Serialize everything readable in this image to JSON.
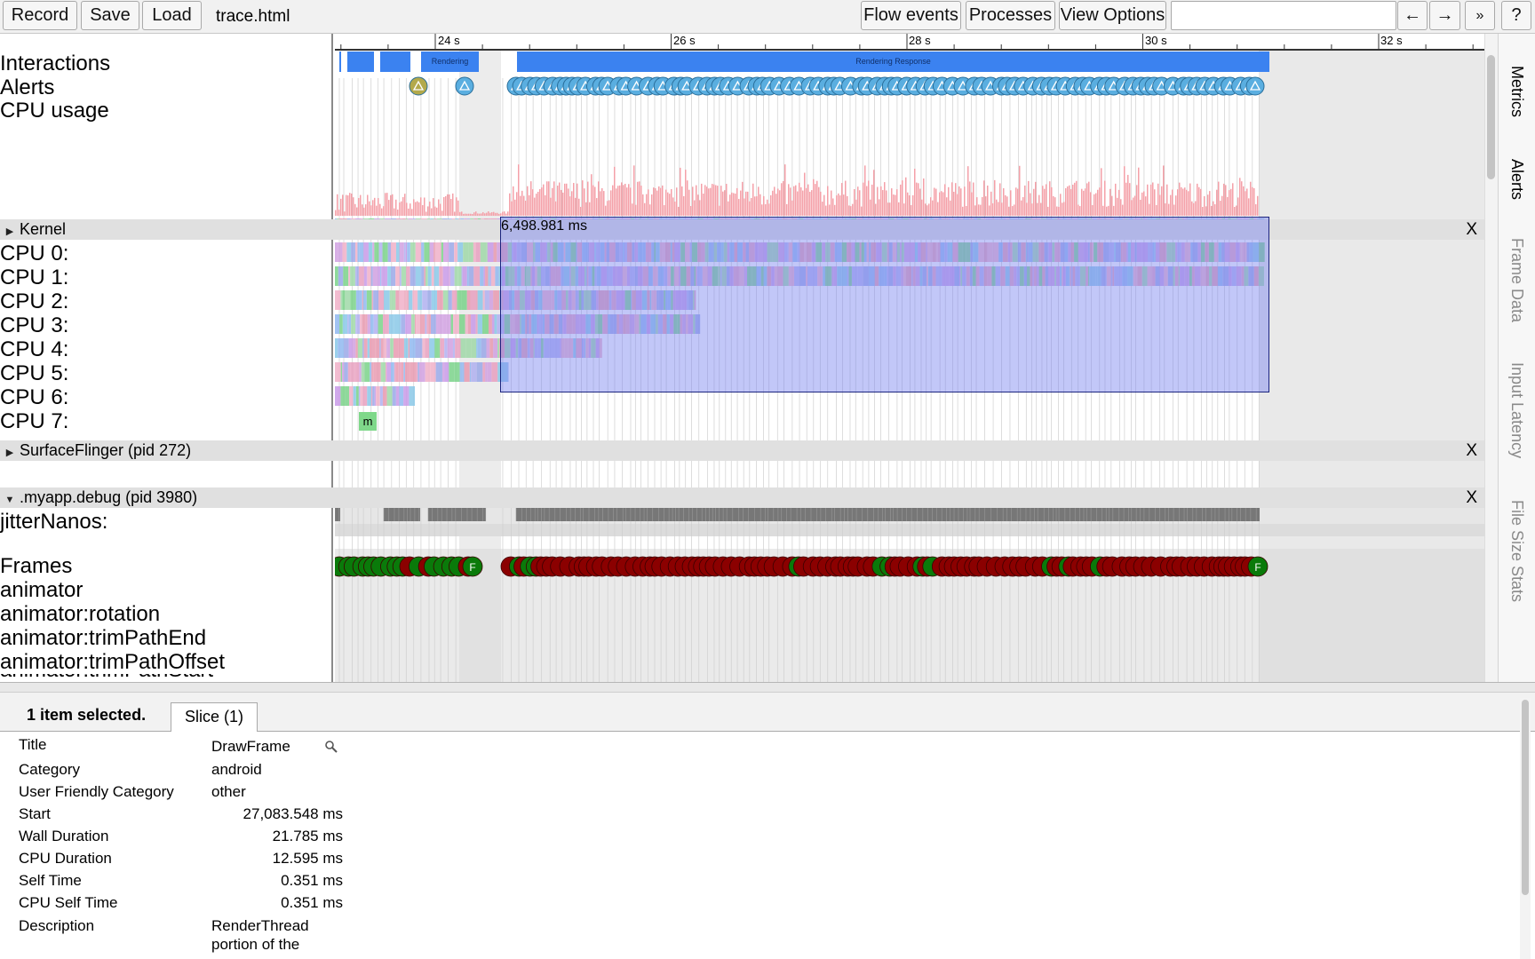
{
  "toolbar": {
    "record": "Record",
    "save": "Save",
    "load": "Load",
    "filename": "trace.html",
    "flow_events": "Flow events",
    "processes": "Processes",
    "view_options": "View Options",
    "search_placeholder": "",
    "prev": "←",
    "next": "→",
    "more": "»",
    "help": "?"
  },
  "ruler": {
    "ticks": [
      "24 s",
      "26 s",
      "28 s",
      "30 s",
      "32 s"
    ]
  },
  "tracks": {
    "interactions": "Interactions",
    "alerts": "Alerts",
    "cpu_usage": "CPU usage",
    "rendering_response": "Rendering Response",
    "cpus": [
      "CPU 0:",
      "CPU 1:",
      "CPU 2:",
      "CPU 3:",
      "CPU 4:",
      "CPU 5:",
      "CPU 6:",
      "CPU 7:"
    ],
    "cpu7_marker": "m",
    "jitter": "jitterNanos:",
    "frames": "Frames",
    "frame_marker": "F",
    "animator": "animator",
    "animator_rotation": "animator:rotation",
    "animator_trim_end": "animator:trimPathEnd",
    "animator_trim_offset": "animator:trimPathOffset",
    "animator_trim_start_partial": "animator:trimPathStart"
  },
  "groups": {
    "kernel": "Kernel",
    "surfaceflinger": "SurfaceFlinger (pid 272)",
    "myapp": ".myapp.debug (pid 3980)",
    "close": "X"
  },
  "selection": {
    "duration_label": "6,498.981 ms"
  },
  "side_tabs": [
    "Metrics",
    "Alerts",
    "Frame Data",
    "Input Latency",
    "File Size Stats"
  ],
  "analysis": {
    "summary": "1 item selected.",
    "tab": "Slice (1)",
    "rows": [
      {
        "key": "Title",
        "value": "DrawFrame"
      },
      {
        "key": "Category",
        "value": "android"
      },
      {
        "key": "User Friendly Category",
        "value": "other"
      },
      {
        "key": "Start",
        "value": "27,083.548 ms"
      },
      {
        "key": "Wall Duration",
        "value": "21.785 ms"
      },
      {
        "key": "CPU Duration",
        "value": "12.595 ms"
      },
      {
        "key": "Self Time",
        "value": "0.351 ms"
      },
      {
        "key": "CPU Self Time",
        "value": "0.351 ms"
      },
      {
        "key": "Description",
        "value": "RenderThread"
      }
    ],
    "description_line2": "portion of the",
    "title_search_icon": "magnifier-icon"
  },
  "colors": {
    "interaction_blue": "#3b82f0",
    "selection_fill": "#9da6f2",
    "frame_red": "#8b0000",
    "frame_green": "#0a7a0a",
    "alert_blue": "#5aaee0",
    "alert_olive": "#b3a94a",
    "cpu_usage_pink": "#f4a0a8",
    "sf_gray": "#777777"
  }
}
